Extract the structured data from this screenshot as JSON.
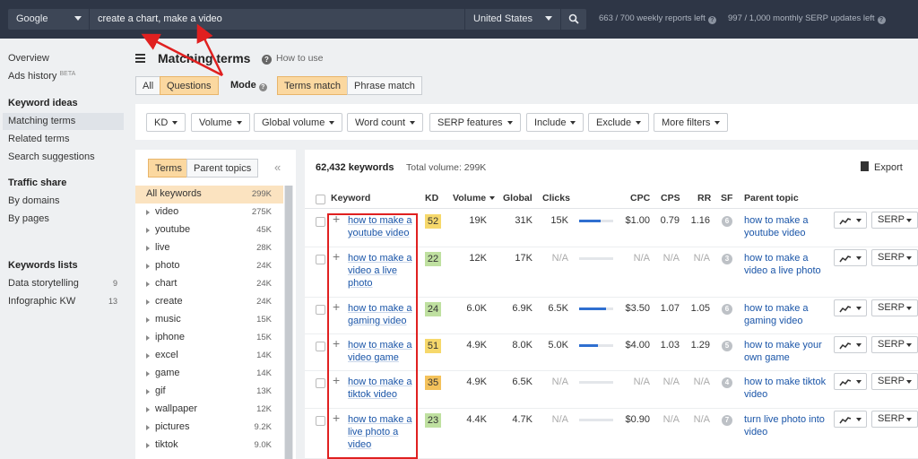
{
  "search": {
    "engine": "Google",
    "query": "create a chart, make a video",
    "country": "United States",
    "quota_reports": "663 / 700 weekly reports left",
    "quota_serp": "997 / 1,000 monthly SERP updates left"
  },
  "nav": {
    "overview": "Overview",
    "ads_history": "Ads history",
    "ads_history_badge": "BETA",
    "keyword_ideas_head": "Keyword ideas",
    "matching_terms": "Matching terms",
    "related_terms": "Related terms",
    "search_suggestions": "Search suggestions",
    "traffic_share_head": "Traffic share",
    "by_domains": "By domains",
    "by_pages": "By pages",
    "keywords_lists_head": "Keywords lists",
    "lists": [
      {
        "label": "Data storytelling",
        "count": "9"
      },
      {
        "label": "Infographic KW",
        "count": "13"
      }
    ]
  },
  "header": {
    "title": "Matching terms",
    "how_to": "How to use",
    "match_tabs": [
      "All",
      "Questions"
    ],
    "mode_label": "Mode",
    "mode_tabs": [
      "Terms match",
      "Phrase match"
    ]
  },
  "filters": [
    "KD",
    "Volume",
    "Global volume",
    "Word count",
    "SERP features",
    "Include",
    "Exclude",
    "More filters"
  ],
  "tree": {
    "tabs": [
      "Terms",
      "Parent topics"
    ],
    "collapse": "«",
    "items": [
      {
        "label": "All keywords",
        "count": "299K"
      },
      {
        "label": "video",
        "count": "275K"
      },
      {
        "label": "youtube",
        "count": "45K"
      },
      {
        "label": "live",
        "count": "28K"
      },
      {
        "label": "photo",
        "count": "24K"
      },
      {
        "label": "chart",
        "count": "24K"
      },
      {
        "label": "create",
        "count": "24K"
      },
      {
        "label": "music",
        "count": "15K"
      },
      {
        "label": "iphone",
        "count": "15K"
      },
      {
        "label": "excel",
        "count": "14K"
      },
      {
        "label": "game",
        "count": "14K"
      },
      {
        "label": "gif",
        "count": "13K"
      },
      {
        "label": "wallpaper",
        "count": "12K"
      },
      {
        "label": "pictures",
        "count": "9.2K"
      },
      {
        "label": "tiktok",
        "count": "9.0K"
      }
    ]
  },
  "results": {
    "count": "62,432 keywords",
    "total_volume": "Total volume: 299K",
    "export": "Export",
    "columns": [
      "Keyword",
      "KD",
      "Volume",
      "Global",
      "Clicks",
      "CPC",
      "CPS",
      "RR",
      "SF",
      "Parent topic"
    ],
    "serp_label": "SERP",
    "colors": {
      "kd_yellow": "#f6d86b",
      "kd_green": "#bfe0a0",
      "kd_orange": "#f4c25b",
      "click_bar": "#2f6fd0"
    },
    "rows": [
      {
        "keyword": "how to make a youtube video",
        "kd": "52",
        "kd_color": "#f6d86b",
        "volume": "19K",
        "global": "31K",
        "clicks": "15K",
        "clicks_pct": 0.62,
        "cpc": "$1.00",
        "cps": "0.79",
        "rr": "1.16",
        "sf": "6",
        "parent": "how to make a youtube video"
      },
      {
        "keyword": "how to make a video a live photo",
        "kd": "22",
        "kd_color": "#bfe0a0",
        "volume": "12K",
        "global": "17K",
        "clicks": "N/A",
        "clicks_pct": 0,
        "cpc": "N/A",
        "cps": "N/A",
        "rr": "N/A",
        "sf": "3",
        "parent": "how to make a video a live photo"
      },
      {
        "keyword": "how to make a gaming video",
        "kd": "24",
        "kd_color": "#bfe0a0",
        "volume": "6.0K",
        "global": "6.9K",
        "clicks": "6.5K",
        "clicks_pct": 0.8,
        "cpc": "$3.50",
        "cps": "1.07",
        "rr": "1.05",
        "sf": "6",
        "parent": "how to make a gaming video"
      },
      {
        "keyword": "how to make a video game",
        "kd": "51",
        "kd_color": "#f6d86b",
        "volume": "4.9K",
        "global": "8.0K",
        "clicks": "5.0K",
        "clicks_pct": 0.55,
        "cpc": "$4.00",
        "cps": "1.03",
        "rr": "1.29",
        "sf": "5",
        "parent": "how to make your own game"
      },
      {
        "keyword": "how to make a tiktok video",
        "kd": "35",
        "kd_color": "#f4c25b",
        "volume": "4.9K",
        "global": "6.5K",
        "clicks": "N/A",
        "clicks_pct": 0,
        "cpc": "N/A",
        "cps": "N/A",
        "rr": "N/A",
        "sf": "4",
        "parent": "how to make tiktok video"
      },
      {
        "keyword": "how to make a live photo a video",
        "kd": "23",
        "kd_color": "#bfe0a0",
        "volume": "4.4K",
        "global": "4.7K",
        "clicks": "N/A",
        "clicks_pct": 0,
        "cpc": "$0.90",
        "cps": "N/A",
        "rr": "N/A",
        "sf": "7",
        "parent": "turn live photo into video"
      }
    ]
  }
}
